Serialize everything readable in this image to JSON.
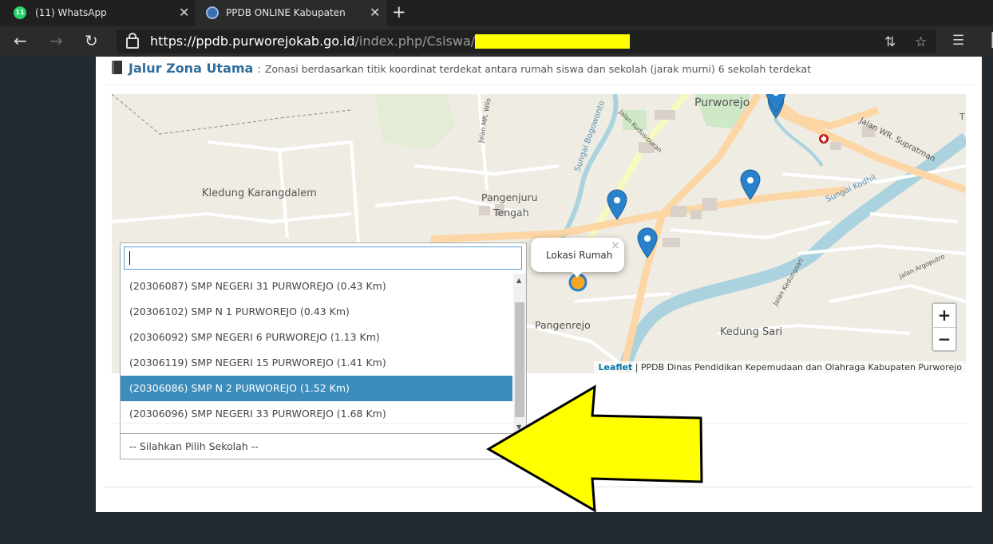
{
  "browser": {
    "tabs": [
      {
        "title": "(11) WhatsApp",
        "badge": "11"
      },
      {
        "title": "PPDB ONLINE Kabupaten Purworejo"
      }
    ],
    "url_main": "https://ppdb.purworejokab.go.id",
    "url_path": "/index.php/Csiswa/pilihse"
  },
  "section": {
    "title": "Jalur Zona Utama",
    "separator": ":",
    "description": "Zonasi berdasarkan titik koordinat terdekat antara rumah siswa dan sekolah (jarak murni) 6 sekolah terdekat"
  },
  "map": {
    "labels": {
      "purworejo": "Purworejo",
      "kledung": "Kledung Karangdalem",
      "pangenjuru1": "Pangenjuru",
      "pangenjuru2": "Tengah",
      "pangenrejo": "Pangenrejo",
      "kedung_sari": "Kedung Sari",
      "sungai_bogowonto": "Sungai Bogowonto",
      "sungai_kodhil": "Sungai Kodhil",
      "jalan_wr": "Jalan WR. Supratman",
      "jalan_kudusipuran": "Jalan Kudusipuran",
      "jalan_mr": "Jalan MR. Wilo",
      "jalan_argoputro": "Jalan Argoputro",
      "jalan_kedungsari": "Jalan Kedungsari",
      "edge_t": "T"
    },
    "popup": "Lokasi Rumah",
    "popup_close": "×",
    "zoom_in": "+",
    "zoom_out": "−",
    "attribution_link": "Leaflet",
    "attribution_text": " | PPDB Dinas Pendidikan Kepemudaan dan Olahraga Kabupaten Purworejo",
    "colors": {
      "land": "#efece4",
      "water": "#aad3df",
      "major_road": "#fcd6a4",
      "secondary_road": "#f7fabf",
      "marker": "#2a81cb",
      "home": "#f5a623"
    }
  },
  "dropdown": {
    "search_value": "",
    "options": [
      "(20306087) SMP NEGERI 31 PURWOREJO (0.43 Km)",
      "(20306102) SMP N 1 PURWOREJO (0.43 Km)",
      "(20306092) SMP NEGERI 6 PURWOREJO (1.13 Km)",
      "(20306119) SMP NEGERI 15 PURWOREJO (1.41 Km)",
      "(20306086) SMP N 2 PURWOREJO (1.52 Km)",
      "(20306096) SMP NEGERI 33 PURWOREJO (1.68 Km)"
    ],
    "highlighted_index": 4,
    "current_value": "-- Silahkan Pilih Sekolah --"
  }
}
